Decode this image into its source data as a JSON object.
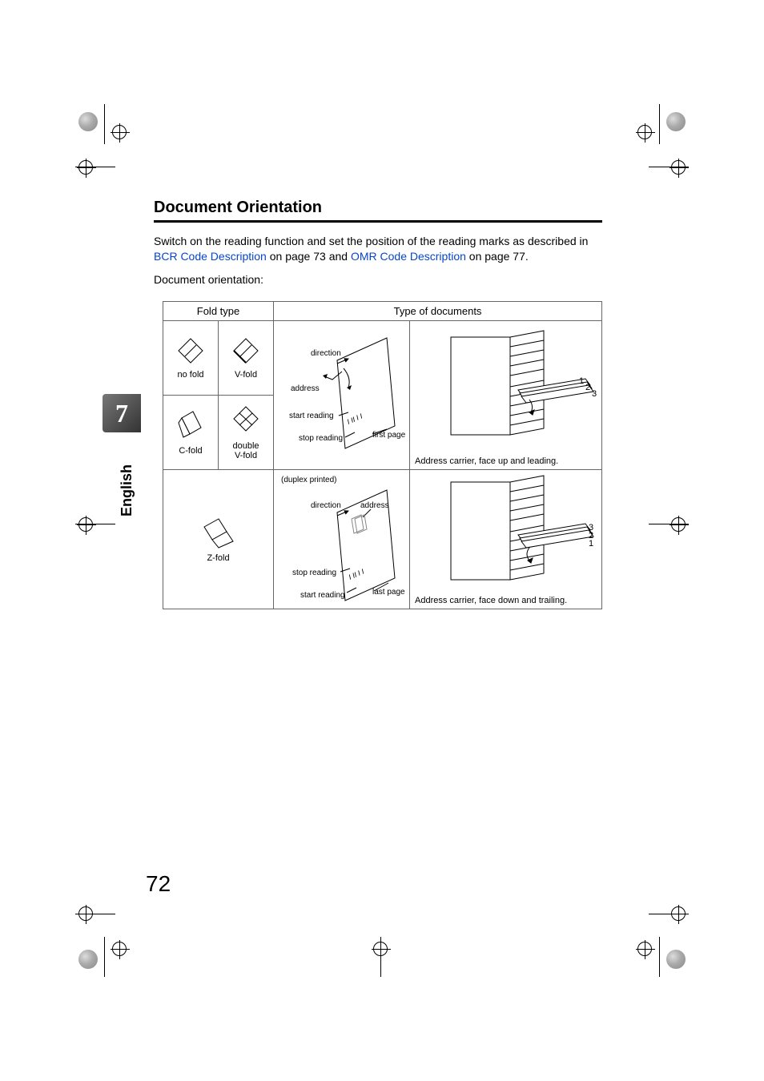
{
  "heading": "Document Orientation",
  "intro_prefix": "Switch on the reading function and set the position of the reading marks as described in ",
  "link1": "BCR Code Description",
  "intro_mid": " on page 73 and ",
  "link2": "OMR Code Description",
  "intro_suffix": " on page 77.",
  "orientation_label": "Document orientation:",
  "tab_number": "7",
  "lang_label": "English",
  "page_number": "72",
  "table": {
    "header_fold": "Fold type",
    "header_docs": "Type of documents",
    "cells": {
      "nofold": "no fold",
      "vfold": "V-fold",
      "cfold": "C-fold",
      "double_vfold_1": "double",
      "double_vfold_2": "V-fold",
      "zfold": "Z-fold"
    },
    "sheet1": {
      "direction": "direction",
      "address": "address",
      "start": "start reading",
      "stop": "stop reading",
      "barcode": "I II I I",
      "first_page": "first page"
    },
    "sheet2": {
      "duplex": "(duplex printed)",
      "direction": "direction",
      "address": "address",
      "stop": "stop reading",
      "start": "start reading",
      "barcode": "I II I I",
      "last_page": "last page"
    },
    "feeder1": {
      "caption": "Address carrier, face up and leading.",
      "n1": "1",
      "n2": "2",
      "n3": "3"
    },
    "feeder2": {
      "caption": "Address carrier, face down and trailing.",
      "n1": "1",
      "n2": "2",
      "n3": "3"
    }
  }
}
